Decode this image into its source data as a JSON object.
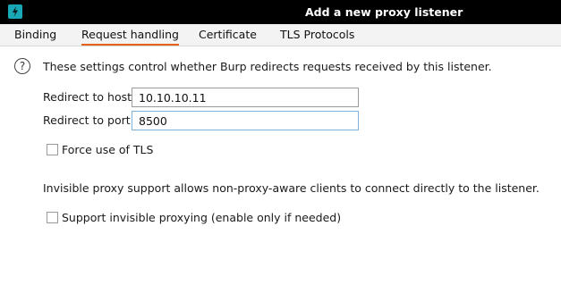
{
  "window": {
    "title": "Add a new proxy listener",
    "accent": "#e8611a",
    "icon": "burp-lightning-icon"
  },
  "tabs": [
    {
      "label": "Binding",
      "active": false
    },
    {
      "label": "Request handling",
      "active": true
    },
    {
      "label": "Certificate",
      "active": false
    },
    {
      "label": "TLS Protocols",
      "active": false
    }
  ],
  "content": {
    "help_icon_glyph": "?",
    "description": "These settings control whether Burp redirects requests received by this listener.",
    "redirect_host_label": "Redirect to host:",
    "redirect_host_value": "10.10.10.11",
    "redirect_port_label": "Redirect to port:",
    "redirect_port_value": "8500",
    "force_tls_label": "Force use of TLS",
    "force_tls_checked": false,
    "invisible_description": "Invisible proxy support allows non-proxy-aware clients to connect directly to the listener.",
    "invisible_proxy_label": "Support invisible proxying (enable only if needed)",
    "invisible_proxy_checked": false
  }
}
